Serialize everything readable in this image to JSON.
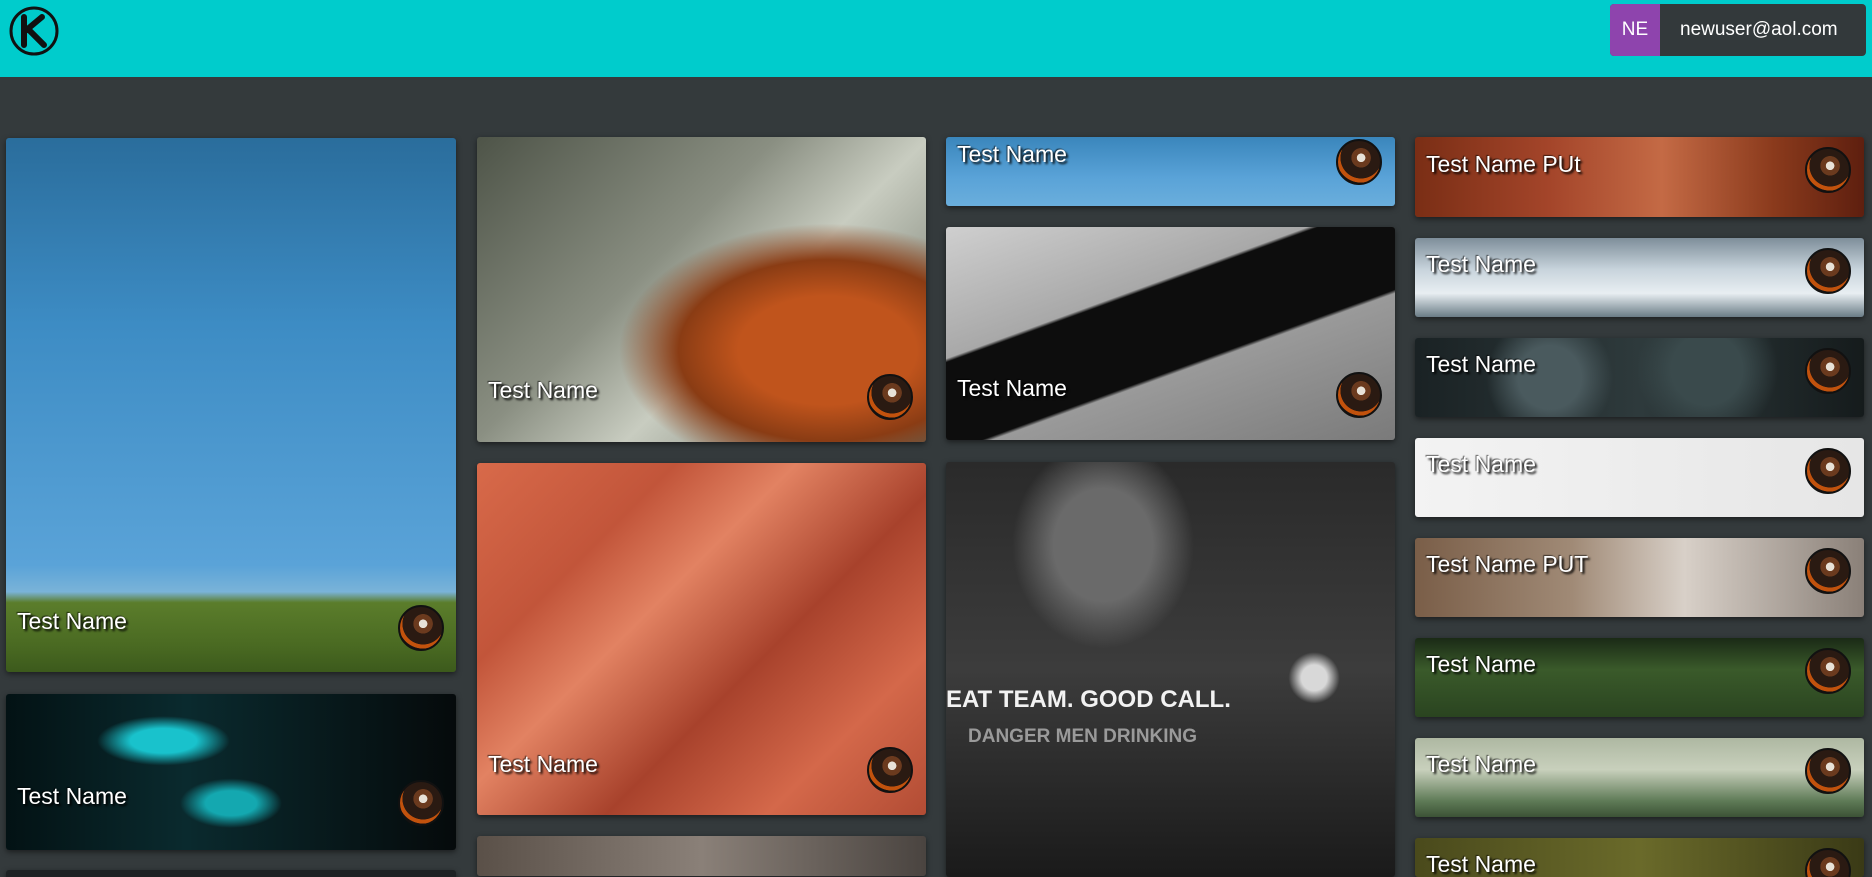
{
  "header": {
    "user": {
      "initials": "NE",
      "email": "newuser@aol.com"
    }
  },
  "gallery": {
    "cards": [
      {
        "title": "Test Name",
        "image": "blue-sky-clouds-hills"
      },
      {
        "title": "Test Name",
        "image": "teal-digital-screen"
      },
      {
        "title": "Test Name",
        "image": "fox-portrait"
      },
      {
        "title": "Test Name",
        "image": "orange-building-balconies"
      },
      {
        "title": "",
        "image": "stone-texture"
      },
      {
        "title": "Test Name",
        "image": "sky-clouds"
      },
      {
        "title": "Test Name",
        "image": "concrete-blocks"
      },
      {
        "title": "",
        "image": "black-white-jacket",
        "overlay_text": "EAT TEAM. GOOD CALL.",
        "overlay_text2": "DANGER MEN DRINKING"
      },
      {
        "title": "Test Name PUt",
        "image": "wood-rings"
      },
      {
        "title": "Test Name",
        "image": "snowy-pines"
      },
      {
        "title": "Test Name",
        "image": "dark-bokeh"
      },
      {
        "title": "Test Name",
        "image": "white-surface"
      },
      {
        "title": "Test Name PUT",
        "image": "rock-surface"
      },
      {
        "title": "Test Name",
        "image": "pine-forest-aerial"
      },
      {
        "title": "Test Name",
        "image": "misty-forest"
      },
      {
        "title": "Test Name",
        "image": "mossy-forest"
      }
    ]
  },
  "colors": {
    "header_bg": "#00cccc",
    "page_bg": "#343a3c",
    "avatar_bg": "#8e44ad"
  },
  "icons": [
    "k-logo-icon",
    "user-avatar-icon"
  ]
}
